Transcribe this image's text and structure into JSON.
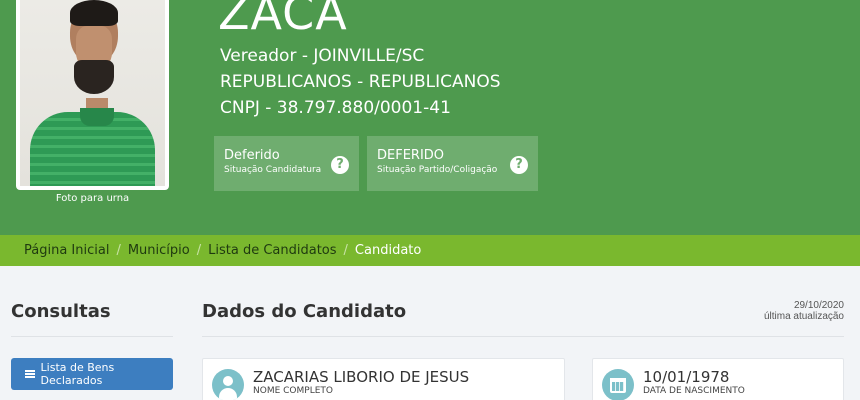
{
  "candidate": {
    "photo_caption": "Foto para urna",
    "name": "ZACA",
    "office_line": "Vereador - JOINVILLE/SC",
    "party_line": "REPUBLICANOS - REPUBLICANOS",
    "cnpj_line": "CNPJ - 38.797.880/0001-41"
  },
  "status": [
    {
      "value": "Deferido",
      "label": "Situação Candidatura",
      "icon": "question-circle-icon"
    },
    {
      "value": "DEFERIDO",
      "label": "Situação Partido/Coligação",
      "icon": "question-circle-icon"
    }
  ],
  "breadcrumb": {
    "separator": "/",
    "items": [
      "Página Inicial",
      "Município",
      "Lista de Candidatos"
    ],
    "active": "Candidato"
  },
  "sidebar": {
    "title": "Consultas",
    "bens_button": "Lista de Bens Declarados",
    "bens_icon": "list-icon"
  },
  "main": {
    "title": "Dados do Candidato",
    "update_date": "29/10/2020",
    "update_label": "última atualização"
  },
  "cards": [
    {
      "value": "ZACARIAS LIBORIO DE JESUS",
      "label": "NOME COMPLETO",
      "icon": "user-icon"
    },
    {
      "value": "10/01/1978",
      "label": "DATA DE NASCIMENTO",
      "icon": "calendar-icon"
    }
  ],
  "colors": {
    "header_green": "#4e9a4e",
    "status_box": "#6fad6f",
    "breadcrumb_green": "#7ab82e",
    "button_blue": "#3d7ec0",
    "card_icon_teal": "#7cc0c9"
  }
}
